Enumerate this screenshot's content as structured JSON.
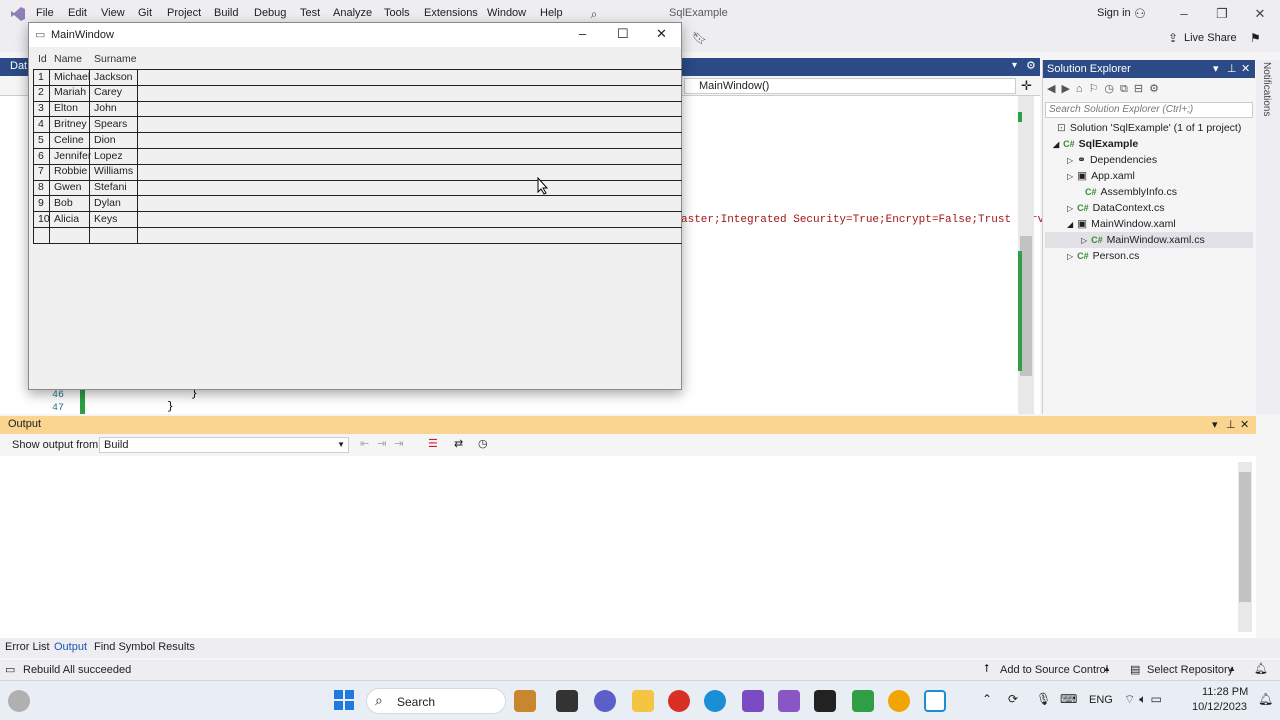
{
  "menu": {
    "items": [
      "File",
      "Edit",
      "View",
      "Git",
      "Project",
      "Build",
      "Debug",
      "Test",
      "Analyze",
      "Tools",
      "Extensions",
      "Window",
      "Help"
    ],
    "title": "SqlExample",
    "sign_in": "Sign in",
    "live_share": "Live Share"
  },
  "editor": {
    "tab_fragment": "Dat",
    "member_dropdown": "MainWindow()",
    "code_fragment": "aster;Integrated Security=True;Encrypt=False;Trust Serve",
    "line_46": "46",
    "line_47": "47",
    "brace": "}"
  },
  "solution_explorer": {
    "title": "Solution Explorer",
    "search_placeholder": "Search Solution Explorer (Ctrl+;)",
    "solution": "Solution 'SqlExample' (1 of 1 project)",
    "project": "SqlExample",
    "items": [
      "Dependencies",
      "App.xaml",
      "AssemblyInfo.cs",
      "DataContext.cs",
      "MainWindow.xaml",
      "MainWindow.xaml.cs",
      "Person.cs"
    ]
  },
  "notifications_label": "Notifications",
  "output": {
    "title": "Output",
    "show_from_label": "Show output from:",
    "source": "Build"
  },
  "bottom_tabs": [
    "Error List",
    "Output",
    "Find Symbol Results"
  ],
  "status": {
    "message": "Rebuild All succeeded",
    "add_source": "Add to Source Control",
    "select_repo": "Select Repository"
  },
  "taskbar": {
    "search": "Search",
    "lang": "ENG",
    "time": "11:28 PM",
    "date": "10/12/2023"
  },
  "main_window": {
    "title": "MainWindow",
    "columns": [
      "Id",
      "Name",
      "Surname"
    ],
    "rows": [
      [
        "1",
        "Michael",
        "Jackson"
      ],
      [
        "2",
        "Mariah",
        "Carey"
      ],
      [
        "3",
        "Elton",
        "John"
      ],
      [
        "4",
        "Britney",
        "Spears"
      ],
      [
        "5",
        "Celine",
        "Dion"
      ],
      [
        "6",
        "Jennifer",
        "Lopez"
      ],
      [
        "7",
        "Robbie",
        "Williams"
      ],
      [
        "8",
        "Gwen",
        "Stefani"
      ],
      [
        "9",
        "Bob",
        "Dylan"
      ],
      [
        "10",
        "Alicia",
        "Keys"
      ]
    ]
  }
}
